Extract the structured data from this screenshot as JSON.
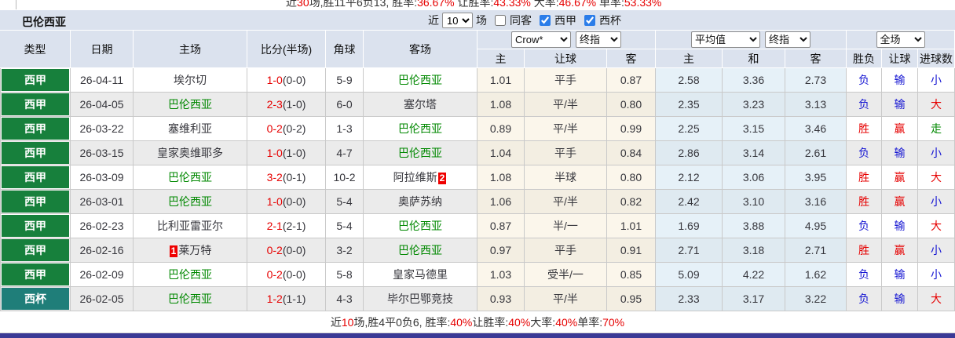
{
  "colors": {
    "liga_badge": "#17803c",
    "cup_badge": "#1f7e79",
    "accent_red": "#e60000",
    "accent_blue": "#1414d2",
    "accent_green": "#008800",
    "bottom_bar": "#3b3a96"
  },
  "top_partial_summary": {
    "segments": [
      {
        "t": "近"
      },
      {
        "t": "30",
        "c": "red"
      },
      {
        "t": "场,胜11平6负13, 胜率:"
      },
      {
        "t": "36.67%",
        "c": "red"
      },
      {
        "t": " 让胜率:"
      },
      {
        "t": "43.33%",
        "c": "red"
      },
      {
        "t": " 大率:"
      },
      {
        "t": "46.67%",
        "c": "red"
      },
      {
        "t": " 单率:"
      },
      {
        "t": "53.33%",
        "c": "red"
      }
    ]
  },
  "team_panel": {
    "team_name": "巴伦西亚",
    "near_label": "近",
    "count_selected": "10",
    "count_options": [
      "10"
    ],
    "matches_label": "场",
    "same_venue": {
      "label": "同客",
      "checked": false
    },
    "filters": [
      {
        "label": "西甲",
        "checked": true
      },
      {
        "label": "西杯",
        "checked": true
      }
    ]
  },
  "header": {
    "columns_left": [
      "类型",
      "日期",
      "主场",
      "比分(半场)",
      "角球",
      "客场"
    ],
    "columns_right": [
      "主",
      "让球",
      "客",
      "主",
      "和",
      "客",
      "胜负",
      "让球",
      "进球数"
    ],
    "selectors": {
      "odds_source": "Crow*",
      "odds_time": "终指",
      "europe_mode": "平均值",
      "europe_time": "终指",
      "scope": "全场"
    }
  },
  "matches": [
    {
      "type": "西甲",
      "kind": "liga",
      "date": "26-04-11",
      "home": {
        "name": "埃尔切",
        "green": false
      },
      "score": "1-0",
      "half": "(0-0)",
      "corners": "5-9",
      "away": {
        "name": "巴伦西亚",
        "green": true
      },
      "odds": [
        "1.01",
        "平手",
        "0.87",
        "2.58",
        "3.36",
        "2.73"
      ],
      "verdicts": [
        {
          "t": "负",
          "c": "blue"
        },
        {
          "t": "输",
          "c": "blue"
        },
        {
          "t": "小",
          "c": "blue"
        }
      ]
    },
    {
      "type": "西甲",
      "kind": "liga",
      "date": "26-04-05",
      "home": {
        "name": "巴伦西亚",
        "green": true
      },
      "score": "2-3",
      "half": "(1-0)",
      "corners": "6-0",
      "away": {
        "name": "塞尔塔",
        "green": false
      },
      "odds": [
        "1.08",
        "平/半",
        "0.80",
        "2.35",
        "3.23",
        "3.13"
      ],
      "verdicts": [
        {
          "t": "负",
          "c": "blue"
        },
        {
          "t": "输",
          "c": "blue"
        },
        {
          "t": "大",
          "c": "red"
        }
      ]
    },
    {
      "type": "西甲",
      "kind": "liga",
      "date": "26-03-22",
      "home": {
        "name": "塞维利亚",
        "green": false
      },
      "score": "0-2",
      "half": "(0-2)",
      "corners": "1-3",
      "away": {
        "name": "巴伦西亚",
        "green": true
      },
      "odds": [
        "0.89",
        "平/半",
        "0.99",
        "2.25",
        "3.15",
        "3.46"
      ],
      "verdicts": [
        {
          "t": "胜",
          "c": "red"
        },
        {
          "t": "赢",
          "c": "red"
        },
        {
          "t": "走",
          "c": "green"
        }
      ]
    },
    {
      "type": "西甲",
      "kind": "liga",
      "date": "26-03-15",
      "home": {
        "name": "皇家奥维耶多",
        "green": false
      },
      "score": "1-0",
      "half": "(1-0)",
      "corners": "4-7",
      "away": {
        "name": "巴伦西亚",
        "green": true
      },
      "odds": [
        "1.04",
        "平手",
        "0.84",
        "2.86",
        "3.14",
        "2.61"
      ],
      "verdicts": [
        {
          "t": "负",
          "c": "blue"
        },
        {
          "t": "输",
          "c": "blue"
        },
        {
          "t": "小",
          "c": "blue"
        }
      ]
    },
    {
      "type": "西甲",
      "kind": "liga",
      "date": "26-03-09",
      "home": {
        "name": "巴伦西亚",
        "green": true
      },
      "score": "3-2",
      "half": "(0-1)",
      "corners": "10-2",
      "away": {
        "name": "阿拉维斯",
        "green": false,
        "badge_after": "2"
      },
      "odds": [
        "1.08",
        "半球",
        "0.80",
        "2.12",
        "3.06",
        "3.95"
      ],
      "verdicts": [
        {
          "t": "胜",
          "c": "red"
        },
        {
          "t": "赢",
          "c": "red"
        },
        {
          "t": "大",
          "c": "red"
        }
      ]
    },
    {
      "type": "西甲",
      "kind": "liga",
      "date": "26-03-01",
      "home": {
        "name": "巴伦西亚",
        "green": true
      },
      "score": "1-0",
      "half": "(0-0)",
      "corners": "5-4",
      "away": {
        "name": "奥萨苏纳",
        "green": false
      },
      "odds": [
        "1.06",
        "平/半",
        "0.82",
        "2.42",
        "3.10",
        "3.16"
      ],
      "verdicts": [
        {
          "t": "胜",
          "c": "red"
        },
        {
          "t": "赢",
          "c": "red"
        },
        {
          "t": "小",
          "c": "blue"
        }
      ]
    },
    {
      "type": "西甲",
      "kind": "liga",
      "date": "26-02-23",
      "home": {
        "name": "比利亚雷亚尔",
        "green": false
      },
      "score": "2-1",
      "half": "(2-1)",
      "corners": "5-4",
      "away": {
        "name": "巴伦西亚",
        "green": true
      },
      "odds": [
        "0.87",
        "半/一",
        "1.01",
        "1.69",
        "3.88",
        "4.95"
      ],
      "verdicts": [
        {
          "t": "负",
          "c": "blue"
        },
        {
          "t": "输",
          "c": "blue"
        },
        {
          "t": "大",
          "c": "red"
        }
      ]
    },
    {
      "type": "西甲",
      "kind": "liga",
      "date": "26-02-16",
      "home": {
        "name": "莱万特",
        "green": false,
        "badge_before": "1"
      },
      "score": "0-2",
      "half": "(0-0)",
      "corners": "3-2",
      "away": {
        "name": "巴伦西亚",
        "green": true
      },
      "odds": [
        "0.97",
        "平手",
        "0.91",
        "2.71",
        "3.18",
        "2.71"
      ],
      "verdicts": [
        {
          "t": "胜",
          "c": "red"
        },
        {
          "t": "赢",
          "c": "red"
        },
        {
          "t": "小",
          "c": "blue"
        }
      ]
    },
    {
      "type": "西甲",
      "kind": "liga",
      "date": "26-02-09",
      "home": {
        "name": "巴伦西亚",
        "green": true
      },
      "score": "0-2",
      "half": "(0-0)",
      "corners": "5-8",
      "away": {
        "name": "皇家马德里",
        "green": false
      },
      "odds": [
        "1.03",
        "受半/一",
        "0.85",
        "5.09",
        "4.22",
        "1.62"
      ],
      "verdicts": [
        {
          "t": "负",
          "c": "blue"
        },
        {
          "t": "输",
          "c": "blue"
        },
        {
          "t": "小",
          "c": "blue"
        }
      ]
    },
    {
      "type": "西杯",
      "kind": "cup",
      "date": "26-02-05",
      "home": {
        "name": "巴伦西亚",
        "green": true
      },
      "score": "1-2",
      "half": "(1-1)",
      "corners": "4-3",
      "away": {
        "name": "毕尔巴鄂竞技",
        "green": false
      },
      "odds": [
        "0.93",
        "平/半",
        "0.95",
        "2.33",
        "3.17",
        "3.22"
      ],
      "verdicts": [
        {
          "t": "负",
          "c": "blue"
        },
        {
          "t": "输",
          "c": "blue"
        },
        {
          "t": "大",
          "c": "red"
        }
      ]
    }
  ],
  "summary": {
    "segments": [
      {
        "t": "近"
      },
      {
        "t": "10",
        "c": "red"
      },
      {
        "t": "场,胜4平0负6, 胜率:"
      },
      {
        "t": "40%",
        "c": "red"
      },
      {
        "t": " 让胜率:"
      },
      {
        "t": "40%",
        "c": "red"
      },
      {
        "t": " 大率:"
      },
      {
        "t": "40%",
        "c": "red"
      },
      {
        "t": " 单率:"
      },
      {
        "t": "70%",
        "c": "red"
      }
    ]
  }
}
